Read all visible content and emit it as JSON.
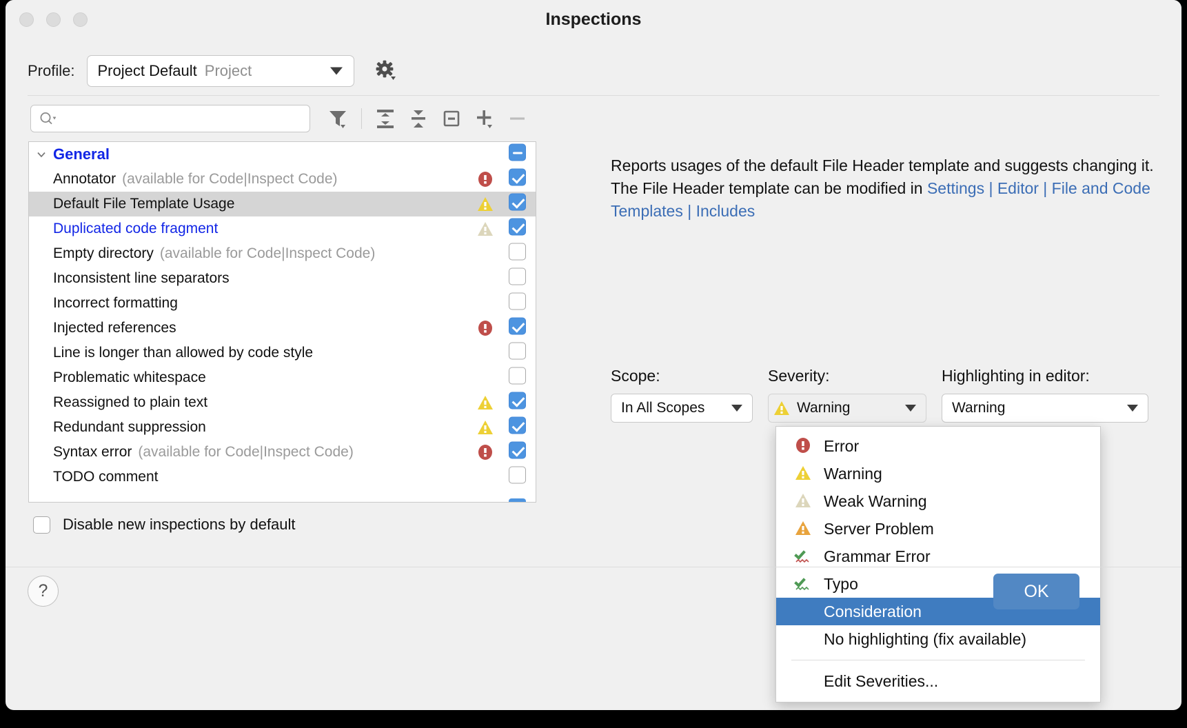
{
  "window": {
    "title": "Inspections",
    "traffic_lights": [
      "close-button",
      "minimize-button",
      "zoom-button"
    ]
  },
  "profile": {
    "label": "Profile:",
    "value": "Project Default",
    "scope_suffix": "Project",
    "gear_icon": "gear-icon"
  },
  "toolbar": {
    "search_placeholder": "",
    "search_icon": "search-icon",
    "buttons": [
      {
        "name": "filter-icon",
        "title": "Filter"
      },
      {
        "name": "expand-all-icon",
        "title": "Expand All"
      },
      {
        "name": "collapse-all-icon",
        "title": "Collapse All"
      },
      {
        "name": "reset-icon",
        "title": "Reset"
      },
      {
        "name": "add-icon",
        "title": "Add"
      },
      {
        "name": "remove-icon",
        "title": "Remove"
      }
    ]
  },
  "tree": {
    "group": {
      "label": "General",
      "expanded": true,
      "checkbox": "mixed"
    },
    "items": [
      {
        "label": "Annotator",
        "hint": "(available for Code|Inspect Code)",
        "severity": "error",
        "checkbox": "on",
        "selected": false,
        "link": false
      },
      {
        "label": "Default File Template Usage",
        "hint": "",
        "severity": "warning",
        "checkbox": "on",
        "selected": true,
        "link": false
      },
      {
        "label": "Duplicated code fragment",
        "hint": "",
        "severity": "weak",
        "checkbox": "on",
        "selected": false,
        "link": true
      },
      {
        "label": "Empty directory",
        "hint": "(available for Code|Inspect Code)",
        "severity": "none",
        "checkbox": "off",
        "selected": false,
        "link": false
      },
      {
        "label": "Inconsistent line separators",
        "hint": "",
        "severity": "none",
        "checkbox": "off",
        "selected": false,
        "link": false
      },
      {
        "label": "Incorrect formatting",
        "hint": "",
        "severity": "none",
        "checkbox": "off",
        "selected": false,
        "link": false
      },
      {
        "label": "Injected references",
        "hint": "",
        "severity": "error",
        "checkbox": "on",
        "selected": false,
        "link": false
      },
      {
        "label": "Line is longer than allowed by code style",
        "hint": "",
        "severity": "none",
        "checkbox": "off",
        "selected": false,
        "link": false
      },
      {
        "label": "Problematic whitespace",
        "hint": "",
        "severity": "none",
        "checkbox": "off",
        "selected": false,
        "link": false
      },
      {
        "label": "Reassigned to plain text",
        "hint": "",
        "severity": "warning",
        "checkbox": "on",
        "selected": false,
        "link": false
      },
      {
        "label": "Redundant suppression",
        "hint": "",
        "severity": "warning",
        "checkbox": "on",
        "selected": false,
        "link": false
      },
      {
        "label": "Syntax error",
        "hint": "(available for Code|Inspect Code)",
        "severity": "error",
        "checkbox": "on",
        "selected": false,
        "link": false
      },
      {
        "label": "TODO comment",
        "hint": "",
        "severity": "none",
        "checkbox": "off",
        "selected": false,
        "link": false
      }
    ]
  },
  "disable_new": {
    "label": "Disable new inspections by default",
    "checked": false
  },
  "description": {
    "text_1": "Reports usages of the default File Header template and suggests changing it. The File Header template can be modified in ",
    "link_1": "Settings | Editor | File and Code Templates | Includes"
  },
  "fields": {
    "scope": {
      "label": "Scope:",
      "value": "In All Scopes"
    },
    "severity": {
      "label": "Severity:",
      "value": "Warning",
      "icon": "warning-icon"
    },
    "highlighting": {
      "label": "Highlighting in editor:",
      "value": "Warning"
    }
  },
  "severity_menu": {
    "items": [
      {
        "label": "Error",
        "icon": "error-icon",
        "selected": false
      },
      {
        "label": "Warning",
        "icon": "warning-icon",
        "selected": false
      },
      {
        "label": "Weak Warning",
        "icon": "weak-warning-icon",
        "selected": false
      },
      {
        "label": "Server Problem",
        "icon": "server-problem-icon",
        "selected": false
      },
      {
        "label": "Grammar Error",
        "icon": "grammar-error-icon",
        "selected": false
      },
      {
        "label": "Typo",
        "icon": "typo-icon",
        "selected": false
      },
      {
        "label": "Consideration",
        "icon": "none",
        "selected": true
      },
      {
        "label": "No highlighting (fix available)",
        "icon": "none",
        "selected": false
      }
    ],
    "footer": {
      "label": "Edit Severities...",
      "icon": "none"
    }
  },
  "footer": {
    "help_label": "?",
    "ok_label": "OK"
  },
  "colors": {
    "accent": "#4d94e0",
    "selection": "#3f7cc0",
    "link": "#3b6db5",
    "tree_link": "#1226e6",
    "error": "#bf4e4a",
    "warning": "#edd035",
    "weak_warning": "#dcd6bb",
    "server_problem": "#e8a33d",
    "grammar_green": "#4f9a55",
    "ok_button": "#5288c4"
  }
}
